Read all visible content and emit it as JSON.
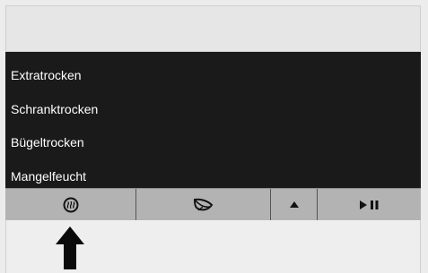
{
  "menu": {
    "items": [
      {
        "label": "Extratrocken"
      },
      {
        "label": "Schranktrocken"
      },
      {
        "label": "Bügeltrocken"
      },
      {
        "label": "Mangelfeucht"
      }
    ]
  },
  "toolbar": {
    "buttons": [
      {
        "icon": "heater-icon"
      },
      {
        "icon": "leaf-eco-icon"
      },
      {
        "icon": "triangle-up-icon"
      },
      {
        "icon": "play-pause-icon"
      }
    ]
  },
  "colors": {
    "display_bg": "#1a1a1a",
    "toolbar_bg": "#b3b3b3",
    "panel_bg": "#ececec"
  }
}
